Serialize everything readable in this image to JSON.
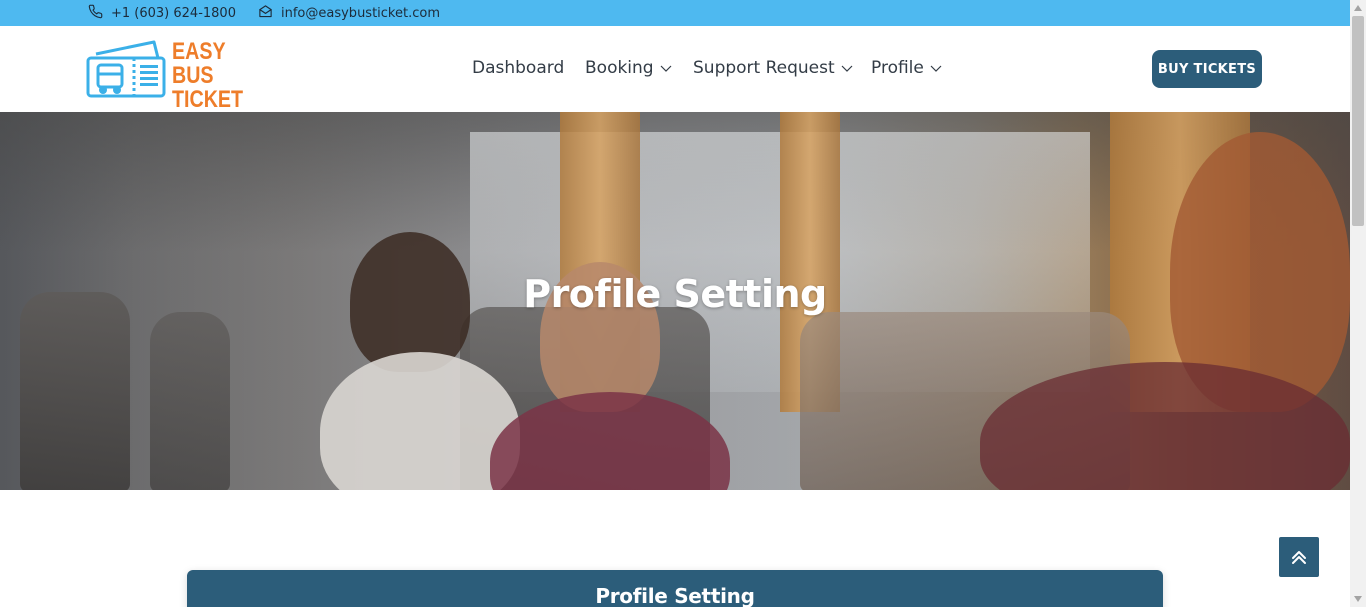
{
  "topbar": {
    "phone": "+1 (603) 624-1800",
    "email": "info@easybusticket.com",
    "phone_icon": "phone-icon",
    "email_icon": "envelope-icon",
    "background": "#4eb9f0"
  },
  "logo": {
    "line1": "EASY BUS",
    "line2": "TICKET",
    "icon": "bus-ticket-icon",
    "brand_color": "#ee7d2a",
    "icon_color": "#3bb0e8"
  },
  "nav": {
    "items": [
      {
        "label": "Dashboard",
        "has_dropdown": false
      },
      {
        "label": "Booking",
        "has_dropdown": true
      },
      {
        "label": "Support Request",
        "has_dropdown": true
      },
      {
        "label": "Profile",
        "has_dropdown": true
      }
    ],
    "buy_button": "BUY TICKETS",
    "accent": "#2c5d7a"
  },
  "hero": {
    "title": "Profile Setting"
  },
  "content": {
    "card_title": "Profile Setting"
  },
  "scroll_top_icon": "chevron-up-icon"
}
